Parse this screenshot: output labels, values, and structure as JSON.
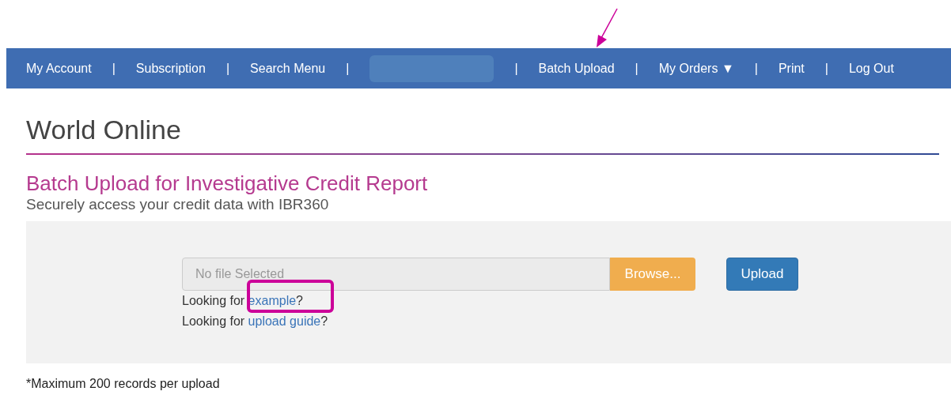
{
  "nav": {
    "items": [
      {
        "kind": "link",
        "label": "My Account"
      },
      {
        "kind": "separator",
        "label": "|"
      },
      {
        "kind": "link",
        "label": "Subscription"
      },
      {
        "kind": "separator",
        "label": "|"
      },
      {
        "kind": "link",
        "label": "Search Menu"
      },
      {
        "kind": "separator",
        "label": "|"
      },
      {
        "kind": "redacted"
      },
      {
        "kind": "separator",
        "label": "|"
      },
      {
        "kind": "link",
        "label": "Batch Upload"
      },
      {
        "kind": "separator",
        "label": "|"
      },
      {
        "kind": "dropdown",
        "label": "My Orders",
        "caret": "▼"
      },
      {
        "kind": "separator",
        "label": "|"
      },
      {
        "kind": "link",
        "label": "Print"
      },
      {
        "kind": "separator",
        "label": "|"
      },
      {
        "kind": "link",
        "label": "Log Out"
      }
    ]
  },
  "page_title": "World Online",
  "section": {
    "title": "Batch Upload for Investigative Credit Report",
    "subtitle": "Securely access your credit data with IBR360"
  },
  "upload": {
    "file_field": {
      "placeholder": "No file Selected"
    },
    "browse_button": "Browse...",
    "upload_button": "Upload",
    "help_lines": [
      {
        "prefix": "Looking for",
        "link": "example",
        "suffix": "?"
      },
      {
        "prefix": "Looking for",
        "link": "upload guide",
        "suffix": "?"
      }
    ]
  },
  "footnote": "*Maximum 200 records per upload"
}
